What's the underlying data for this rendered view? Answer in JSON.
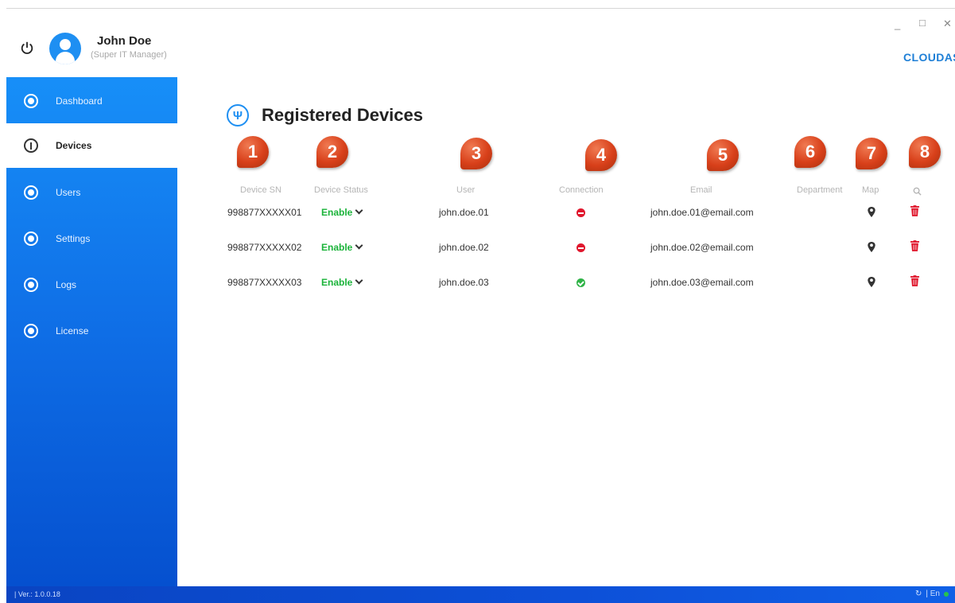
{
  "window": {
    "minimize": "_",
    "maximize": "□",
    "close": "✕"
  },
  "user": {
    "name": "John Doe",
    "role": "(Super IT Manager)"
  },
  "brand": {
    "name": "CLOUDASHUR",
    "mark": "®",
    "color": "#1e7fd6"
  },
  "sidebar": {
    "items": [
      {
        "label": "Dashboard",
        "icon": "dashboard-icon",
        "active": false
      },
      {
        "label": "Devices",
        "icon": "usb-icon",
        "active": true
      },
      {
        "label": "Users",
        "icon": "users-icon",
        "active": false
      },
      {
        "label": "Settings",
        "icon": "gear-icon",
        "active": false
      },
      {
        "label": "Logs",
        "icon": "logs-icon",
        "active": false
      },
      {
        "label": "License",
        "icon": "license-icon",
        "active": false
      }
    ]
  },
  "main": {
    "title": "Registered Devices",
    "callouts": [
      "1",
      "2",
      "3",
      "4",
      "5",
      "6",
      "7",
      "8"
    ],
    "columns": [
      "Device SN",
      "Device Status",
      "User",
      "Connection",
      "Email",
      "Department",
      "Map"
    ],
    "rows": [
      {
        "sn": "998877XXXXX01",
        "status": "Enable",
        "user": "john.doe.01",
        "connection": "disconnected",
        "email": "john.doe.01@email.com",
        "department": ""
      },
      {
        "sn": "998877XXXXX02",
        "status": "Enable",
        "user": "john.doe.02",
        "connection": "disconnected",
        "email": "john.doe.02@email.com",
        "department": ""
      },
      {
        "sn": "998877XXXXX03",
        "status": "Enable",
        "user": "john.doe.03",
        "connection": "connected",
        "email": "john.doe.03@email.com",
        "department": ""
      }
    ]
  },
  "statusbar": {
    "version": "| Ver.: 1.0.0.18",
    "language": "| En"
  },
  "colors": {
    "accent": "#1e8ff2",
    "enabled": "#1bb33a",
    "disconnected": "#e0172d",
    "connected": "#2fb347",
    "delete": "#e0172d",
    "callout": "#d8401a"
  }
}
